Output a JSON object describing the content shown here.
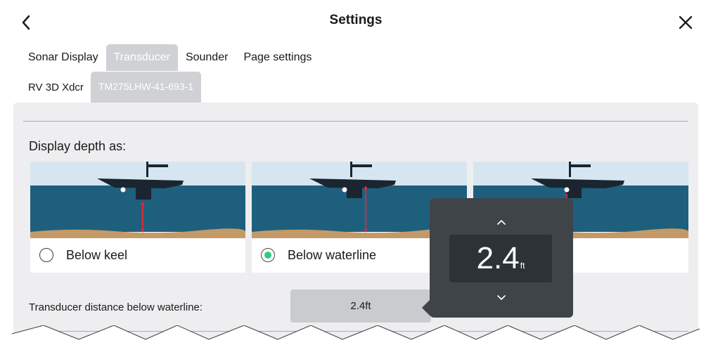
{
  "header": {
    "title": "Settings",
    "back_icon": "chevron-left-icon",
    "close_icon": "close-icon"
  },
  "tabs": [
    {
      "label": "Sonar Display",
      "active": false
    },
    {
      "label": "Transducer",
      "active": true
    },
    {
      "label": "Sounder",
      "active": false
    },
    {
      "label": "Page settings",
      "active": false
    }
  ],
  "transducer": {
    "label": "RV 3D Xdcr",
    "selected": "TM275LHW-41-693-1"
  },
  "depth": {
    "title": "Display depth as:",
    "options": [
      {
        "label": "Below keel",
        "selected": false
      },
      {
        "label": "Below waterline",
        "selected": true
      },
      {
        "label": "Below transducer",
        "visible_label": "nsducer",
        "selected": false
      }
    ]
  },
  "distance": {
    "label": "Transducer distance below waterline:",
    "value": "2.4ft"
  },
  "popup": {
    "value": "2.4",
    "unit": "ft",
    "up_icon": "chevron-up-icon",
    "down_icon": "chevron-down-icon"
  },
  "colors": {
    "sky": "#d6e6f0",
    "water": "#1f5f7e",
    "seabed": "#c39a67",
    "hull": "#1b2530",
    "marker": "#d92a3a",
    "radio_on": "#2ecc83",
    "popup_bg": "#3f4449"
  }
}
